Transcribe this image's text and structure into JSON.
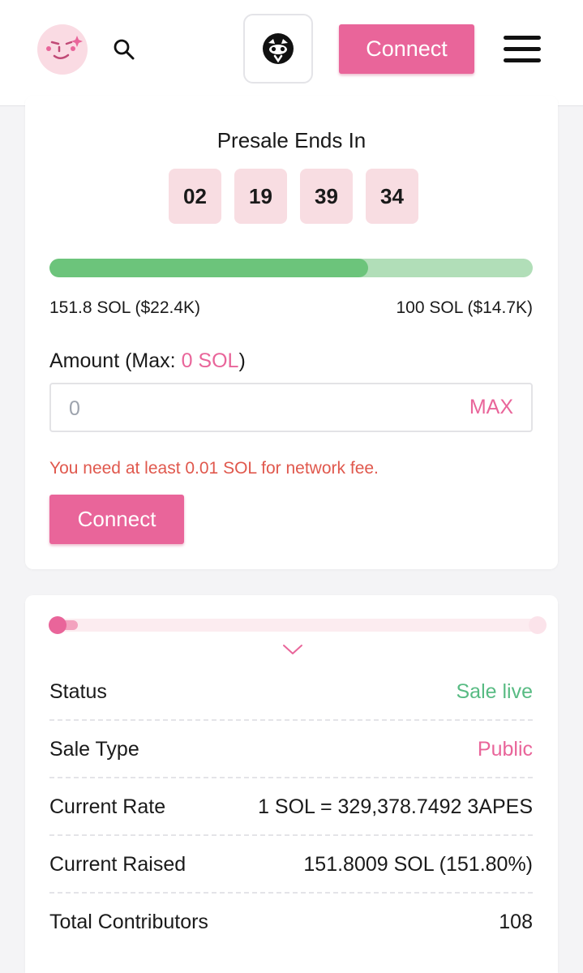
{
  "header": {
    "logo_icon": "smirking-face-logo-icon",
    "search_icon": "search-icon",
    "app_icon": "cat-mask-icon",
    "connect_label": "Connect",
    "menu_icon": "hamburger-menu-icon"
  },
  "presale": {
    "title": "Presale Ends In",
    "countdown": [
      "02",
      "19",
      "39",
      "34"
    ],
    "progress_fraction": 0.66,
    "raised_label": "151.8 SOL ($22.4K)",
    "target_label": "100 SOL ($14.7K)",
    "amount_label_prefix": "Amount (Max: ",
    "amount_label_max": "0 SOL",
    "amount_label_suffix": ")",
    "amount_placeholder": "0",
    "max_button": "MAX",
    "error": "You need at least 0.01 SOL for network fee.",
    "connect_label": "Connect"
  },
  "details": {
    "chevron_icon": "chevron-down-icon",
    "rows": [
      {
        "label": "Status",
        "value": "Sale live"
      },
      {
        "label": "Sale Type",
        "value": "Public"
      },
      {
        "label": "Current Rate",
        "value": "1 SOL = 329,378.7492 3APES"
      },
      {
        "label": "Current Raised",
        "value": "151.8009 SOL (151.80%)"
      },
      {
        "label": "Total Contributors",
        "value": "108"
      }
    ]
  },
  "colors": {
    "accent_pink": "#e9659a",
    "progress_green": "#6cc47b",
    "status_green": "#58bb83",
    "error_red": "#e0584d"
  }
}
